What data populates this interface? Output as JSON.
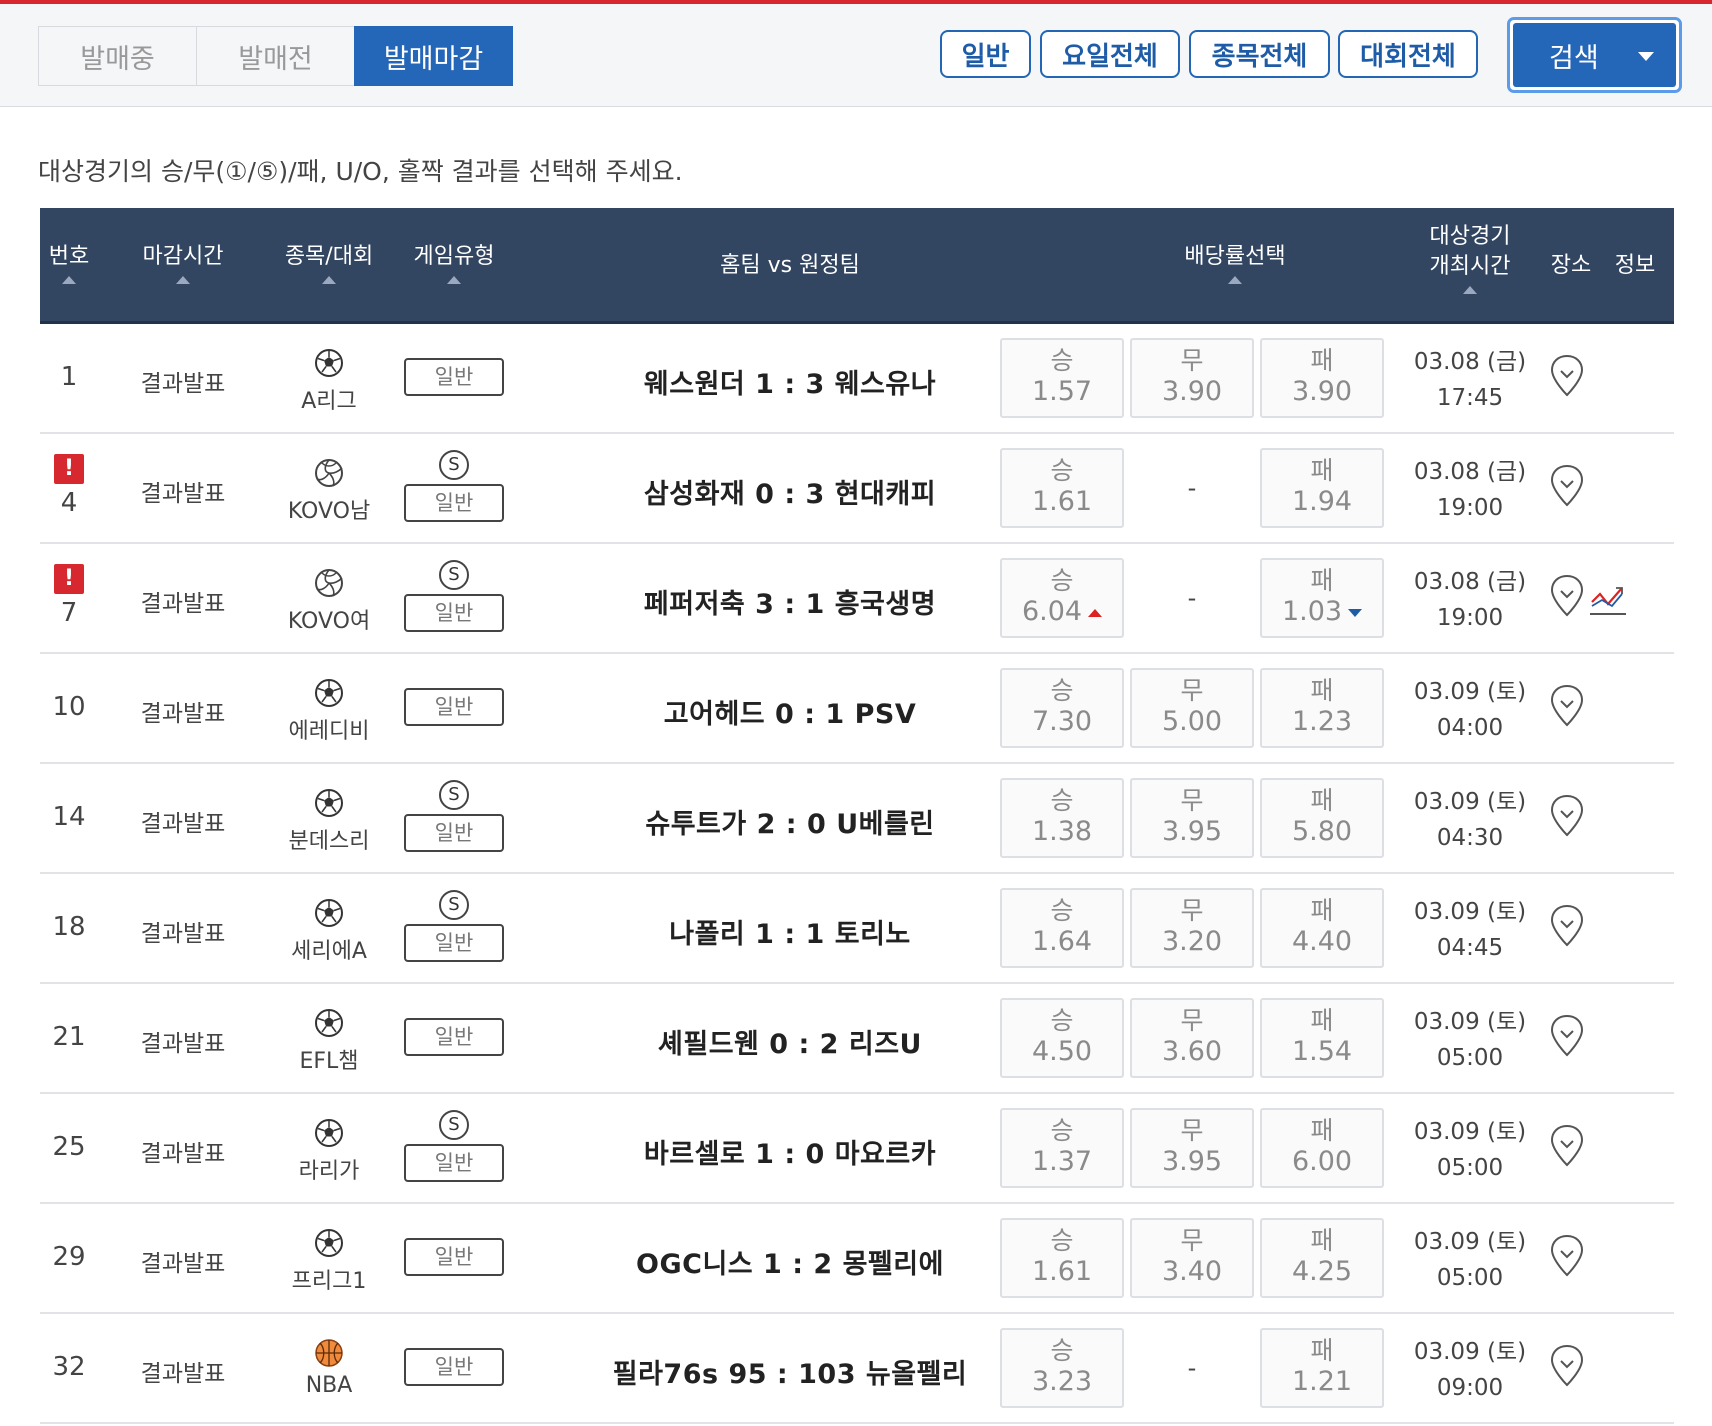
{
  "status_tabs": [
    {
      "label": "발매중"
    },
    {
      "label": "발매전"
    },
    {
      "label": "발매마감"
    }
  ],
  "filters": [
    {
      "label": "일반"
    },
    {
      "label": "요일전체"
    },
    {
      "label": "종목전체"
    },
    {
      "label": "대회전체"
    }
  ],
  "search_label": "검색",
  "instruction": "대상경기의 승/무(①/⑤)/패, U/O, 홀짝 결과를 선택해 주세요.",
  "headers": {
    "num": "번호",
    "deadline": "마감시간",
    "sport": "종목/대회",
    "game_type": "게임유형",
    "match": "홈팀 vs 원정팀",
    "odds": "배당률선택",
    "datetime_1": "대상경기",
    "datetime_2": "개최시간",
    "venue": "장소",
    "info": "정보"
  },
  "rows": [
    {
      "num": "1",
      "alert": false,
      "alert_mark": "!",
      "deadline": "결과발표",
      "sport_icon": "soccer-ball-icon",
      "league": "A리그",
      "special": false,
      "special_mark": "S",
      "game_type": "일반",
      "match": "웨스원더 1 : 3 웨스유나",
      "win_label": "승",
      "win": "1.57",
      "draw_label": "무",
      "draw": "3.90",
      "lose_label": "패",
      "lose": "3.90",
      "date": "03.08 (금)",
      "time": "17:45"
    },
    {
      "num": "4",
      "alert": true,
      "alert_mark": "!",
      "deadline": "결과발표",
      "sport_icon": "volleyball-icon",
      "league": "KOVO남",
      "special": true,
      "special_mark": "S",
      "game_type": "일반",
      "match": "삼성화재 0 : 3 현대캐피",
      "win_label": "승",
      "win": "1.61",
      "draw_label": "",
      "draw": "-",
      "lose_label": "패",
      "lose": "1.94",
      "date": "03.08 (금)",
      "time": "19:00"
    },
    {
      "num": "7",
      "alert": true,
      "alert_mark": "!",
      "deadline": "결과발표",
      "sport_icon": "volleyball-icon",
      "league": "KOVO여",
      "special": true,
      "special_mark": "S",
      "game_type": "일반",
      "match": "페퍼저축 3 : 1 흥국생명",
      "win_label": "승",
      "win": "6.04",
      "win_trend": "up",
      "draw_label": "",
      "draw": "-",
      "lose_label": "패",
      "lose": "1.03",
      "lose_trend": "down",
      "date": "03.08 (금)",
      "time": "19:00",
      "has_chart": true
    },
    {
      "num": "10",
      "alert": false,
      "alert_mark": "!",
      "deadline": "결과발표",
      "sport_icon": "soccer-ball-icon",
      "league": "에레디비",
      "special": false,
      "special_mark": "S",
      "game_type": "일반",
      "match": "고어헤드 0 : 1 PSV",
      "win_label": "승",
      "win": "7.30",
      "draw_label": "무",
      "draw": "5.00",
      "lose_label": "패",
      "lose": "1.23",
      "date": "03.09 (토)",
      "time": "04:00"
    },
    {
      "num": "14",
      "alert": false,
      "alert_mark": "!",
      "deadline": "결과발표",
      "sport_icon": "soccer-ball-icon",
      "league": "분데스리",
      "special": true,
      "special_mark": "S",
      "game_type": "일반",
      "match": "슈투트가 2 : 0 U베를린",
      "win_label": "승",
      "win": "1.38",
      "draw_label": "무",
      "draw": "3.95",
      "lose_label": "패",
      "lose": "5.80",
      "date": "03.09 (토)",
      "time": "04:30"
    },
    {
      "num": "18",
      "alert": false,
      "alert_mark": "!",
      "deadline": "결과발표",
      "sport_icon": "soccer-ball-icon",
      "league": "세리에A",
      "special": true,
      "special_mark": "S",
      "game_type": "일반",
      "match": "나폴리 1 : 1 토리노",
      "win_label": "승",
      "win": "1.64",
      "draw_label": "무",
      "draw": "3.20",
      "lose_label": "패",
      "lose": "4.40",
      "date": "03.09 (토)",
      "time": "04:45"
    },
    {
      "num": "21",
      "alert": false,
      "alert_mark": "!",
      "deadline": "결과발표",
      "sport_icon": "soccer-ball-icon",
      "league": "EFL챔",
      "special": false,
      "special_mark": "S",
      "game_type": "일반",
      "match": "셰필드웬 0 : 2 리즈U",
      "win_label": "승",
      "win": "4.50",
      "draw_label": "무",
      "draw": "3.60",
      "lose_label": "패",
      "lose": "1.54",
      "date": "03.09 (토)",
      "time": "05:00"
    },
    {
      "num": "25",
      "alert": false,
      "alert_mark": "!",
      "deadline": "결과발표",
      "sport_icon": "soccer-ball-icon",
      "league": "라리가",
      "special": true,
      "special_mark": "S",
      "game_type": "일반",
      "match": "바르셀로 1 : 0 마요르카",
      "win_label": "승",
      "win": "1.37",
      "draw_label": "무",
      "draw": "3.95",
      "lose_label": "패",
      "lose": "6.00",
      "date": "03.09 (토)",
      "time": "05:00"
    },
    {
      "num": "29",
      "alert": false,
      "alert_mark": "!",
      "deadline": "결과발표",
      "sport_icon": "soccer-ball-icon",
      "league": "프리그1",
      "special": false,
      "special_mark": "S",
      "game_type": "일반",
      "match": "OGC니스 1 : 2 몽펠리에",
      "win_label": "승",
      "win": "1.61",
      "draw_label": "무",
      "draw": "3.40",
      "lose_label": "패",
      "lose": "4.25",
      "date": "03.09 (토)",
      "time": "05:00"
    },
    {
      "num": "32",
      "alert": false,
      "alert_mark": "!",
      "deadline": "결과발표",
      "sport_icon": "basketball-icon",
      "league": "NBA",
      "special": false,
      "special_mark": "S",
      "game_type": "일반",
      "match": "필라76s 95 : 103 뉴올펠리",
      "win_label": "승",
      "win": "3.23",
      "draw_label": "",
      "draw": "-",
      "lose_label": "패",
      "lose": "1.21",
      "date": "03.09 (토)",
      "time": "09:00"
    }
  ],
  "colors": {
    "accent_blue": "#2466b8",
    "header_navy": "#324561",
    "top_red": "#d7282f",
    "up_red": "#d22222",
    "down_blue": "#1f5ca8"
  }
}
